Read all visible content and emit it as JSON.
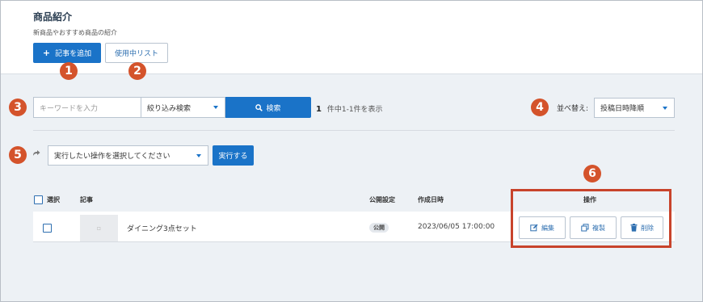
{
  "header": {
    "title": "商品紹介",
    "subtitle": "新商品やおすすめ商品の紹介",
    "add_article_label": "記事を追加",
    "in_use_list_label": "使用中リスト"
  },
  "callouts": [
    "1",
    "2",
    "3",
    "4",
    "5",
    "6"
  ],
  "search": {
    "placeholder": "キーワードを入力",
    "filter_label": "絞り込み検索",
    "search_button_label": "検索",
    "result_count": "1",
    "result_text": "件中1-1件を表示"
  },
  "sort": {
    "label": "並べ替え:",
    "selected": "投稿日時降順"
  },
  "bulk": {
    "action_selected": "実行したい操作を選択してください",
    "execute_label": "実行する"
  },
  "table": {
    "headers": {
      "select": "選択",
      "article": "記事",
      "publish": "公開設定",
      "created": "作成日時",
      "operations": "操作"
    },
    "rows": [
      {
        "title": "ダイニング3点セット",
        "status": "公開",
        "created": "2023/06/05 17:00:00",
        "edit_label": "編集",
        "duplicate_label": "複製",
        "delete_label": "削除"
      }
    ]
  },
  "colors": {
    "accent": "#1a73c8",
    "callout": "#d4532b",
    "highlight_box": "#c8432b"
  }
}
